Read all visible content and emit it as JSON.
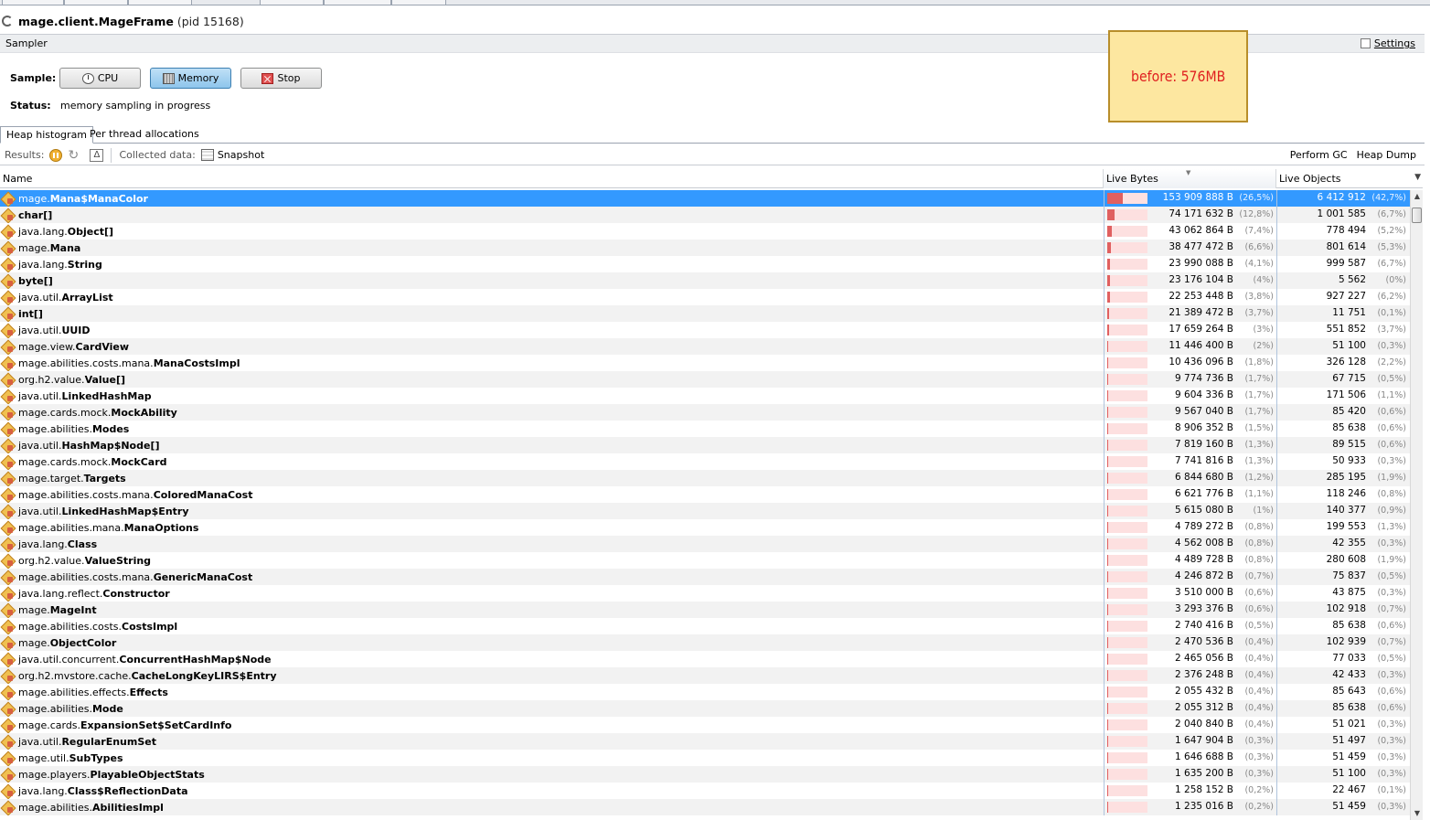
{
  "header": {
    "class_name": "mage.client.MageFrame",
    "pid": "(pid 15168)"
  },
  "sampler": {
    "section_label": "Sampler",
    "settings_label": "Settings",
    "sample_label": "Sample:",
    "cpu_label": "CPU",
    "memory_label": "Memory",
    "stop_label": "Stop",
    "status_label": "Status:",
    "status_value": "memory sampling in progress"
  },
  "note": {
    "text": "before: 576MB"
  },
  "tabs": [
    {
      "label": "Heap histogram",
      "active": true
    },
    {
      "label": "Per thread allocations",
      "active": false
    }
  ],
  "toolbar": {
    "results_label": "Results:",
    "collected_label": "Collected data:",
    "snapshot_label": "Snapshot",
    "perform_gc": "Perform GC",
    "heap_dump": "Heap Dump"
  },
  "columns": {
    "name": "Name",
    "live_bytes": "Live Bytes",
    "live_objects": "Live Objects"
  },
  "rows": [
    {
      "pkg": "mage.",
      "cls": "Mana$ManaColor",
      "bytes": "153 909 888 B",
      "bytes_pct": "(26,5%)",
      "share": 0.265,
      "objs": "6 412 912",
      "objs_pct": "(42,7%)",
      "selected": true,
      "bold_pkg": false
    },
    {
      "pkg": "",
      "cls": "char[]",
      "bytes": "74 171 632 B",
      "bytes_pct": "(12,8%)",
      "share": 0.128,
      "objs": "1 001 585",
      "objs_pct": "(6,7%)"
    },
    {
      "pkg": "java.lang.",
      "cls": "Object[]",
      "bytes": "43 062 864 B",
      "bytes_pct": "(7,4%)",
      "share": 0.074,
      "objs": "778 494",
      "objs_pct": "(5,2%)"
    },
    {
      "pkg": "mage.",
      "cls": "Mana",
      "bytes": "38 477 472 B",
      "bytes_pct": "(6,6%)",
      "share": 0.066,
      "objs": "801 614",
      "objs_pct": "(5,3%)"
    },
    {
      "pkg": "java.lang.",
      "cls": "String",
      "bytes": "23 990 088 B",
      "bytes_pct": "(4,1%)",
      "share": 0.041,
      "objs": "999 587",
      "objs_pct": "(6,7%)"
    },
    {
      "pkg": "",
      "cls": "byte[]",
      "bytes": "23 176 104 B",
      "bytes_pct": "(4%)",
      "share": 0.04,
      "objs": "5 562",
      "objs_pct": "(0%)"
    },
    {
      "pkg": "java.util.",
      "cls": "ArrayList",
      "bytes": "22 253 448 B",
      "bytes_pct": "(3,8%)",
      "share": 0.038,
      "objs": "927 227",
      "objs_pct": "(6,2%)"
    },
    {
      "pkg": "",
      "cls": "int[]",
      "bytes": "21 389 472 B",
      "bytes_pct": "(3,7%)",
      "share": 0.037,
      "objs": "11 751",
      "objs_pct": "(0,1%)"
    },
    {
      "pkg": "java.util.",
      "cls": "UUID",
      "bytes": "17 659 264 B",
      "bytes_pct": "(3%)",
      "share": 0.03,
      "objs": "551 852",
      "objs_pct": "(3,7%)"
    },
    {
      "pkg": "mage.view.",
      "cls": "CardView",
      "bytes": "11 446 400 B",
      "bytes_pct": "(2%)",
      "share": 0.02,
      "objs": "51 100",
      "objs_pct": "(0,3%)"
    },
    {
      "pkg": "mage.abilities.costs.mana.",
      "cls": "ManaCostsImpl",
      "bytes": "10 436 096 B",
      "bytes_pct": "(1,8%)",
      "share": 0.018,
      "objs": "326 128",
      "objs_pct": "(2,2%)"
    },
    {
      "pkg": "org.h2.value.",
      "cls": "Value[]",
      "bytes": "9 774 736 B",
      "bytes_pct": "(1,7%)",
      "share": 0.017,
      "objs": "67 715",
      "objs_pct": "(0,5%)"
    },
    {
      "pkg": "java.util.",
      "cls": "LinkedHashMap",
      "bytes": "9 604 336 B",
      "bytes_pct": "(1,7%)",
      "share": 0.017,
      "objs": "171 506",
      "objs_pct": "(1,1%)"
    },
    {
      "pkg": "mage.cards.mock.",
      "cls": "MockAbility",
      "bytes": "9 567 040 B",
      "bytes_pct": "(1,7%)",
      "share": 0.017,
      "objs": "85 420",
      "objs_pct": "(0,6%)"
    },
    {
      "pkg": "mage.abilities.",
      "cls": "Modes",
      "bytes": "8 906 352 B",
      "bytes_pct": "(1,5%)",
      "share": 0.015,
      "objs": "85 638",
      "objs_pct": "(0,6%)"
    },
    {
      "pkg": "java.util.",
      "cls": "HashMap$Node[]",
      "bytes": "7 819 160 B",
      "bytes_pct": "(1,3%)",
      "share": 0.013,
      "objs": "89 515",
      "objs_pct": "(0,6%)"
    },
    {
      "pkg": "mage.cards.mock.",
      "cls": "MockCard",
      "bytes": "7 741 816 B",
      "bytes_pct": "(1,3%)",
      "share": 0.013,
      "objs": "50 933",
      "objs_pct": "(0,3%)"
    },
    {
      "pkg": "mage.target.",
      "cls": "Targets",
      "bytes": "6 844 680 B",
      "bytes_pct": "(1,2%)",
      "share": 0.012,
      "objs": "285 195",
      "objs_pct": "(1,9%)"
    },
    {
      "pkg": "mage.abilities.costs.mana.",
      "cls": "ColoredManaCost",
      "bytes": "6 621 776 B",
      "bytes_pct": "(1,1%)",
      "share": 0.011,
      "objs": "118 246",
      "objs_pct": "(0,8%)"
    },
    {
      "pkg": "java.util.",
      "cls": "LinkedHashMap$Entry",
      "bytes": "5 615 080 B",
      "bytes_pct": "(1%)",
      "share": 0.01,
      "objs": "140 377",
      "objs_pct": "(0,9%)"
    },
    {
      "pkg": "mage.abilities.mana.",
      "cls": "ManaOptions",
      "bytes": "4 789 272 B",
      "bytes_pct": "(0,8%)",
      "share": 0.008,
      "objs": "199 553",
      "objs_pct": "(1,3%)"
    },
    {
      "pkg": "java.lang.",
      "cls": "Class",
      "bytes": "4 562 008 B",
      "bytes_pct": "(0,8%)",
      "share": 0.008,
      "objs": "42 355",
      "objs_pct": "(0,3%)"
    },
    {
      "pkg": "org.h2.value.",
      "cls": "ValueString",
      "bytes": "4 489 728 B",
      "bytes_pct": "(0,8%)",
      "share": 0.008,
      "objs": "280 608",
      "objs_pct": "(1,9%)"
    },
    {
      "pkg": "mage.abilities.costs.mana.",
      "cls": "GenericManaCost",
      "bytes": "4 246 872 B",
      "bytes_pct": "(0,7%)",
      "share": 0.007,
      "objs": "75 837",
      "objs_pct": "(0,5%)"
    },
    {
      "pkg": "java.lang.reflect.",
      "cls": "Constructor",
      "bytes": "3 510 000 B",
      "bytes_pct": "(0,6%)",
      "share": 0.006,
      "objs": "43 875",
      "objs_pct": "(0,3%)"
    },
    {
      "pkg": "mage.",
      "cls": "MageInt",
      "bytes": "3 293 376 B",
      "bytes_pct": "(0,6%)",
      "share": 0.006,
      "objs": "102 918",
      "objs_pct": "(0,7%)"
    },
    {
      "pkg": "mage.abilities.costs.",
      "cls": "CostsImpl",
      "bytes": "2 740 416 B",
      "bytes_pct": "(0,5%)",
      "share": 0.005,
      "objs": "85 638",
      "objs_pct": "(0,6%)"
    },
    {
      "pkg": "mage.",
      "cls": "ObjectColor",
      "bytes": "2 470 536 B",
      "bytes_pct": "(0,4%)",
      "share": 0.004,
      "objs": "102 939",
      "objs_pct": "(0,7%)"
    },
    {
      "pkg": "java.util.concurrent.",
      "cls": "ConcurrentHashMap$Node",
      "bytes": "2 465 056 B",
      "bytes_pct": "(0,4%)",
      "share": 0.004,
      "objs": "77 033",
      "objs_pct": "(0,5%)"
    },
    {
      "pkg": "org.h2.mvstore.cache.",
      "cls": "CacheLongKeyLIRS$Entry",
      "bytes": "2 376 248 B",
      "bytes_pct": "(0,4%)",
      "share": 0.004,
      "objs": "42 433",
      "objs_pct": "(0,3%)"
    },
    {
      "pkg": "mage.abilities.effects.",
      "cls": "Effects",
      "bytes": "2 055 432 B",
      "bytes_pct": "(0,4%)",
      "share": 0.004,
      "objs": "85 643",
      "objs_pct": "(0,6%)"
    },
    {
      "pkg": "mage.abilities.",
      "cls": "Mode",
      "bytes": "2 055 312 B",
      "bytes_pct": "(0,4%)",
      "share": 0.004,
      "objs": "85 638",
      "objs_pct": "(0,6%)"
    },
    {
      "pkg": "mage.cards.",
      "cls": "ExpansionSet$SetCardInfo",
      "bytes": "2 040 840 B",
      "bytes_pct": "(0,4%)",
      "share": 0.004,
      "objs": "51 021",
      "objs_pct": "(0,3%)"
    },
    {
      "pkg": "java.util.",
      "cls": "RegularEnumSet",
      "bytes": "1 647 904 B",
      "bytes_pct": "(0,3%)",
      "share": 0.003,
      "objs": "51 497",
      "objs_pct": "(0,3%)"
    },
    {
      "pkg": "mage.util.",
      "cls": "SubTypes",
      "bytes": "1 646 688 B",
      "bytes_pct": "(0,3%)",
      "share": 0.003,
      "objs": "51 459",
      "objs_pct": "(0,3%)"
    },
    {
      "pkg": "mage.players.",
      "cls": "PlayableObjectStats",
      "bytes": "1 635 200 B",
      "bytes_pct": "(0,3%)",
      "share": 0.003,
      "objs": "51 100",
      "objs_pct": "(0,3%)"
    },
    {
      "pkg": "java.lang.",
      "cls": "Class$ReflectionData",
      "bytes": "1 258 152 B",
      "bytes_pct": "(0,2%)",
      "share": 0.002,
      "objs": "22 467",
      "objs_pct": "(0,1%)"
    },
    {
      "pkg": "mage.abilities.",
      "cls": "AbilitiesImpl",
      "bytes": "1 235 016 B",
      "bytes_pct": "(0,2%)",
      "share": 0.002,
      "objs": "51 459",
      "objs_pct": "(0,3%)"
    }
  ]
}
